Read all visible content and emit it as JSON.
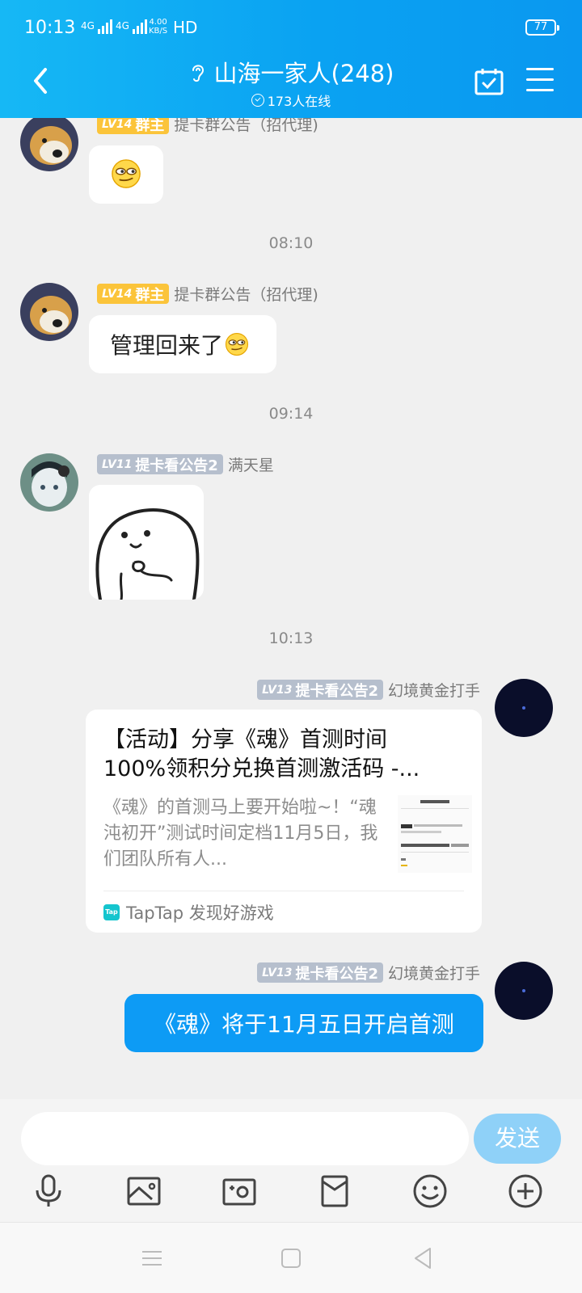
{
  "status_bar": {
    "time": "10:13",
    "net1": "4G",
    "net2": "4G",
    "speed_value": "4.00",
    "speed_unit": "KB/S",
    "hd": "HD",
    "battery": "77"
  },
  "header": {
    "title": "山海一家人(248)",
    "online": "173人在线"
  },
  "messages": [
    {
      "badge_level": "LV14",
      "badge_role": "群主",
      "name": "提卡群公告（招代理)",
      "type": "emoji"
    },
    {
      "timestamp": "08:10"
    },
    {
      "badge_level": "LV14",
      "badge_role": "群主",
      "name": "提卡群公告（招代理)",
      "text": "管理回来了"
    },
    {
      "timestamp": "09:14"
    },
    {
      "badge_level": "LV11",
      "badge_role": "提卡看公告2",
      "name": "满天星",
      "type": "sticker"
    },
    {
      "timestamp": "10:13"
    },
    {
      "badge_level": "LV13",
      "badge_role": "提卡看公告2",
      "name": "幻境黄金打手",
      "card": {
        "title": "【活动】分享《魂》首测时间100%领积分兑换首测激活码 -...",
        "desc": "《魂》的首测马上要开始啦~！“魂沌初开”测试时间定档11月5日，我们团队所有人...",
        "source": "TapTap 发现好游戏",
        "source_icon_text": "Tap"
      }
    },
    {
      "badge_level": "LV13",
      "badge_role": "提卡看公告2",
      "name": "幻境黄金打手",
      "text": "《魂》将于11月五日开启首测"
    }
  ],
  "input": {
    "placeholder": "",
    "value": "",
    "send_label": "发送"
  },
  "toolbar": [
    "microphone-icon",
    "image-icon",
    "camera-icon",
    "red-packet-icon",
    "emoji-icon",
    "plus-icon"
  ],
  "colors": {
    "header_start": "#16b8f5",
    "header_end": "#0a98f0",
    "bubble_blue": "#0d9bf5",
    "send_button": "#8fd1f8",
    "badge_gold": "#fbc43a",
    "badge_gray": "#b6bfcd"
  }
}
